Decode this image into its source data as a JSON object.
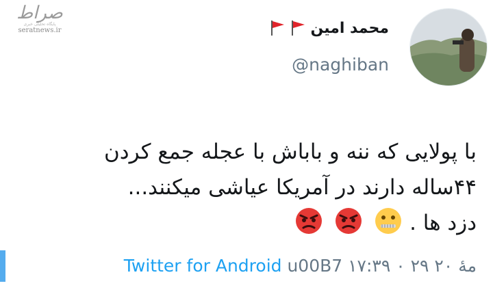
{
  "watermark": {
    "logo": "صراط",
    "tagline": "پایگاه تحلیلی خبری",
    "site": "seratnews.ir"
  },
  "user": {
    "display_name": "محمد امین",
    "flags": [
      "red-flag-icon",
      "red-flag-icon"
    ],
    "handle": "@naghiban"
  },
  "tweet": {
    "lines": [
      "با پولایی که ننه و باباش با عجله جمع کردن",
      "۴۴ساله دارند در آمریکا عیاشی میکنند...",
      "دزد ها ."
    ],
    "emojis": [
      "angry-face-icon",
      "angry-face-icon",
      "zipper-mouth-face-icon"
    ]
  },
  "meta": {
    "timestamp": "۱۷:۳۹ ۰ ۲۹ مهٔ ۲۰",
    "separator": " u00B7 ",
    "source": "Twitter for Android"
  },
  "colors": {
    "accent": "#1da1f2",
    "secondary_text": "#657786",
    "flag_red": "#e0242b"
  }
}
